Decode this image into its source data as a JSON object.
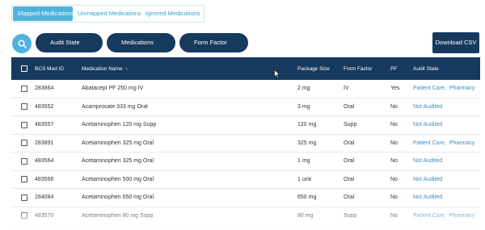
{
  "tabs": [
    {
      "label": "Mapped Medications",
      "active": true
    },
    {
      "label": "Unmapped Medications",
      "active": false
    },
    {
      "label": "Ignored Medications",
      "active": false
    }
  ],
  "toolbar": {
    "search_icon": "search-icon",
    "filters": [
      {
        "label": "Audit State"
      },
      {
        "label": "Medications"
      },
      {
        "label": "Form Factor"
      }
    ],
    "download_label": "Download CSV"
  },
  "table": {
    "columns": [
      "BCS Med ID",
      "Medication Name",
      "Package Size",
      "Form Factor",
      "PF",
      "Audit State"
    ],
    "sort_indicator": "↑",
    "rows": [
      {
        "id": "283864",
        "name": "Abatacept PF 250 mg IV",
        "package": "2 mg",
        "form": "IV",
        "pf": "Yes",
        "audit": [
          "Patient Care,",
          "Pharmacy"
        ]
      },
      {
        "id": "483552",
        "name": "Acamprosate 333 mg Oral",
        "package": "3 mg",
        "form": "Oral",
        "pf": "No",
        "audit": [
          "Not Audited"
        ]
      },
      {
        "id": "483557",
        "name": "Acetaminophen 120 mg Supp",
        "package": "120 mg",
        "form": "Supp",
        "pf": "No",
        "audit": [
          "Not Audited"
        ]
      },
      {
        "id": "283891",
        "name": "Acetaminophen 325 mg Oral",
        "package": "325 mg",
        "form": "Oral",
        "pf": "No",
        "audit": [
          "Patient Care,",
          "Pharmacy"
        ]
      },
      {
        "id": "483564",
        "name": "Acetaminophen 325 mg Oral",
        "package": "1 mg",
        "form": "Oral",
        "pf": "No",
        "audit": [
          "Not Audited"
        ]
      },
      {
        "id": "483566",
        "name": "Acetaminophen 500 mg Oral",
        "package": "1 unit",
        "form": "Oral",
        "pf": "No",
        "audit": [
          "Not Audited"
        ]
      },
      {
        "id": "284084",
        "name": "Acetaminophen 650 mg Oral",
        "package": "650 mg",
        "form": "Oral",
        "pf": "No",
        "audit": [
          "Not Audited"
        ]
      },
      {
        "id": "483570",
        "name": "Acetaminophen 80 mg Supp",
        "package": "80 mg",
        "form": "Supp",
        "pf": "No",
        "audit": [
          "Patient Care,",
          "Pharmacy"
        ]
      }
    ]
  },
  "colors": {
    "accent": "#4fb2dc",
    "navy": "#16395e",
    "link": "#3a8fc8"
  }
}
